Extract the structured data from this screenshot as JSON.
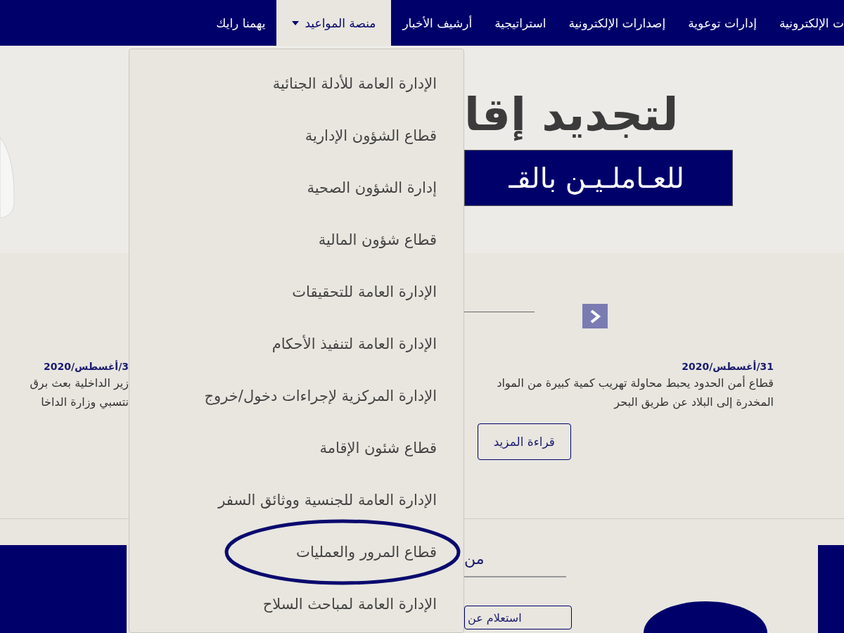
{
  "nav": {
    "items": [
      {
        "label": "ت الإلكترونية",
        "selected": false,
        "dropdown": false
      },
      {
        "label": "إدارات توعوية",
        "selected": false,
        "dropdown": false
      },
      {
        "label": "إصدارات الإلكترونية",
        "selected": false,
        "dropdown": false
      },
      {
        "label": "استراتيجية",
        "selected": false,
        "dropdown": false
      },
      {
        "label": "أرشيف الأخبار",
        "selected": false,
        "dropdown": false
      },
      {
        "label": "منصة المواعيد",
        "selected": true,
        "dropdown": true
      },
      {
        "label": "يهمنا رايك",
        "selected": false,
        "dropdown": false
      }
    ]
  },
  "dropdown": {
    "items": [
      {
        "label": "الإدارة العامة للأدلة الجنائية",
        "circled": false
      },
      {
        "label": "قطاع الشؤون الإدارية",
        "circled": false
      },
      {
        "label": "إدارة الشؤون الصحية",
        "circled": false
      },
      {
        "label": "قطاع شؤون المالية",
        "circled": false
      },
      {
        "label": "الإدارة العامة للتحقيقات",
        "circled": false
      },
      {
        "label": "الإدارة العامة لتنفيذ الأحكام",
        "circled": false
      },
      {
        "label": "الإدارة المركزية لإجراءات دخول/خروج",
        "circled": false
      },
      {
        "label": "قطاع شئون الإقامة",
        "circled": false
      },
      {
        "label": "الإدارة العامة للجنسية ووثائق السفر",
        "circled": false
      },
      {
        "label": "قطاع المرور والعمليات",
        "circled": true
      },
      {
        "label": "الإدارة العامة لمباحث السلاح",
        "circled": false
      }
    ]
  },
  "banner": {
    "headline": "لتجديد إقا",
    "subline": "للعـاملـيـن بالقـ"
  },
  "news": [
    {
      "date": "31/أغسطس/2020",
      "text": "قطاع أمن الحدود يحبط محاولة تهريب كمية كبيرة من المواد المخدرة إلى البلاد عن طريق البحر",
      "button": "قراءة المزيد"
    },
    {
      "date": "3/أغسطس/2020",
      "lines": [
        "زير الداخلية بعث برق",
        "نتسبي وزارة الداخا"
      ]
    }
  ],
  "section": {
    "heading": "من",
    "button": "استعلام عن"
  }
}
